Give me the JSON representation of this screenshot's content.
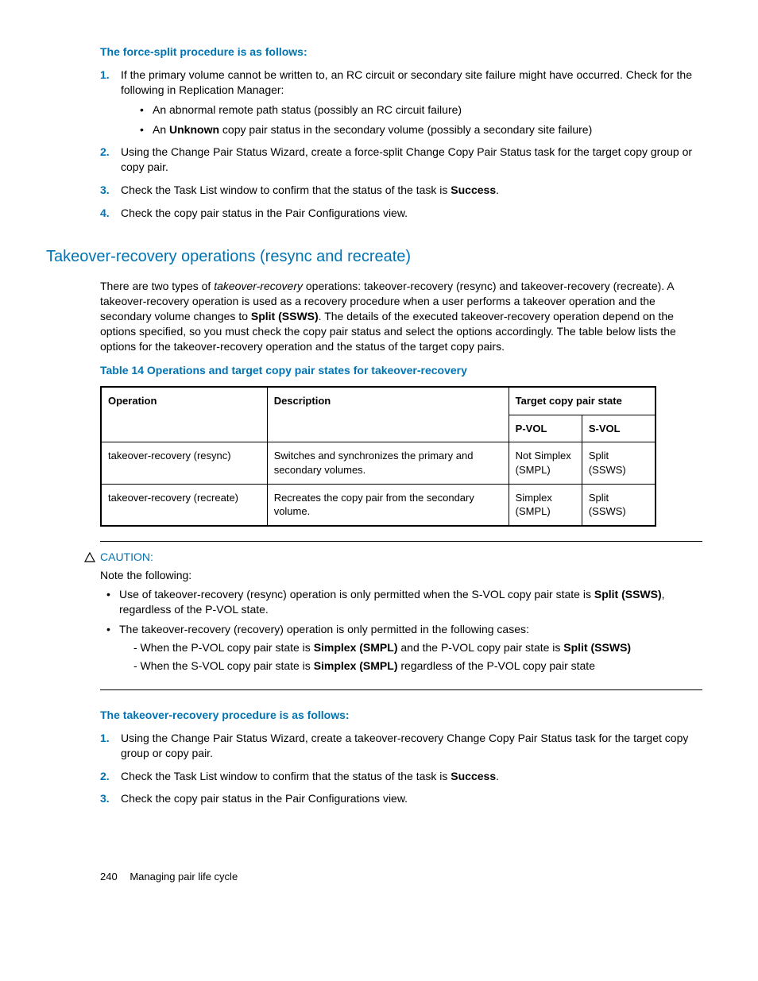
{
  "force_split": {
    "heading": "The force-split procedure is as follows:",
    "steps": [
      {
        "num": "1.",
        "text_pre": "If the primary volume cannot be written to, an RC circuit or secondary site failure might have occurred. Check for the following in Replication Manager:",
        "bullets": [
          {
            "pre": "An abnormal remote path status (possibly an RC circuit failure)"
          },
          {
            "pre": "An ",
            "bold": "Unknown",
            "post": " copy pair status in the secondary volume (possibly a secondary site failure)"
          }
        ]
      },
      {
        "num": "2.",
        "text_pre": "Using the Change Pair Status Wizard, create a force-split Change Copy Pair Status task for the target copy group or copy pair."
      },
      {
        "num": "3.",
        "text_pre": "Check the Task List window to confirm that the status of the task is ",
        "bold": "Success",
        "text_post": "."
      },
      {
        "num": "4.",
        "text_pre": "Check the copy pair status in the Pair Configurations view."
      }
    ]
  },
  "section_heading": "Takeover-recovery operations (resync and recreate)",
  "intro": {
    "pre": "There are two types of ",
    "italic": "takeover-recovery",
    "mid": " operations: takeover-recovery (resync) and takeover-recovery (recreate). A takeover-recovery operation is used as a recovery procedure when a user performs a takeover operation and the secondary volume changes to ",
    "bold": "Split (SSWS)",
    "post": ". The details of the executed takeover-recovery operation depend on the options specified, so you must check the copy pair status and select the options accordingly. The table below lists the options for the takeover-recovery operation and the status of the target copy pairs."
  },
  "table_caption": "Table 14 Operations and target copy pair states for takeover-recovery",
  "table": {
    "headers": {
      "operation": "Operation",
      "description": "Description",
      "target": "Target copy pair state",
      "pvol": "P-VOL",
      "svol": "S-VOL"
    },
    "rows": [
      {
        "op": "takeover-recovery (resync)",
        "desc": "Switches and synchronizes the primary and secondary volumes.",
        "pvol": "Not Simplex (SMPL)",
        "svol": "Split (SSWS)"
      },
      {
        "op": "takeover-recovery (recreate)",
        "desc": "Recreates the copy pair from the secondary volume.",
        "pvol": "Simplex (SMPL)",
        "svol": "Split (SSWS)"
      }
    ]
  },
  "caution": {
    "label": "CAUTION:",
    "note": "Note the following:",
    "bullets": [
      {
        "pre": "Use of takeover-recovery (resync) operation is only permitted when the S-VOL copy pair state is ",
        "bold": "Split (SSWS)",
        "post": ", regardless of the P-VOL state."
      },
      {
        "pre": "The takeover-recovery (recovery) operation is only permitted in the following cases:",
        "dashes": [
          {
            "pre": "- When the P-VOL copy pair state is ",
            "b1": "Simplex (SMPL)",
            "mid": " and the P-VOL copy pair state is ",
            "b2": "Split (SSWS)"
          },
          {
            "pre": "- When the S-VOL copy pair state is ",
            "b1": "Simplex (SMPL)",
            "mid": " regardless of the P-VOL copy pair state"
          }
        ]
      }
    ]
  },
  "takeover_proc": {
    "heading": "The takeover-recovery procedure is as follows:",
    "steps": [
      {
        "num": "1.",
        "text": "Using the Change Pair Status Wizard, create a takeover-recovery Change Copy Pair Status task for the target copy group or copy pair."
      },
      {
        "num": "2.",
        "pre": "Check the Task List window to confirm that the status of the task is ",
        "bold": "Success",
        "post": "."
      },
      {
        "num": "3.",
        "text": "Check the copy pair status in the Pair Configurations view."
      }
    ]
  },
  "footer": {
    "page": "240",
    "title": "Managing pair life cycle"
  }
}
